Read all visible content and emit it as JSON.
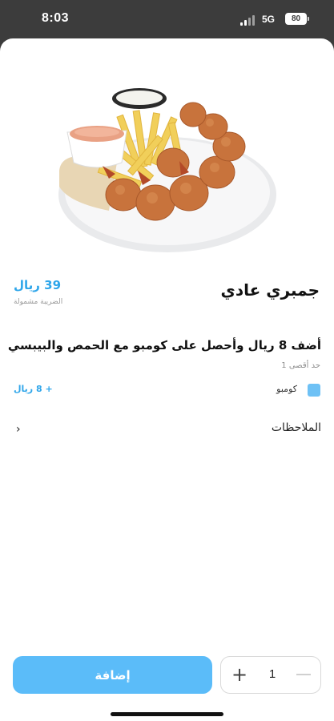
{
  "status_bar": {
    "time": "8:03",
    "network": "5G",
    "battery": "80"
  },
  "product": {
    "image_icon": "shrimp-fries-plate",
    "title": "جمبري عادي",
    "price": "39 ريال",
    "tax_note": "الضريبة مشمولة"
  },
  "addon": {
    "title": "أضف 8 ريال وأحصل على كومبو مع الحمص والبيبسي",
    "limit": "حد أقصى 1",
    "options": [
      {
        "label": "كومبو",
        "price": "+ 8 ريال",
        "checked": true
      }
    ]
  },
  "notes": {
    "label": "الملاحظات",
    "chevron": "›"
  },
  "footer": {
    "add_label": "إضافة",
    "quantity": "1",
    "plus": "+"
  },
  "colors": {
    "accent": "#2fa6ea",
    "button": "#5bbcf9",
    "checkbox": "#6ec1f5"
  }
}
